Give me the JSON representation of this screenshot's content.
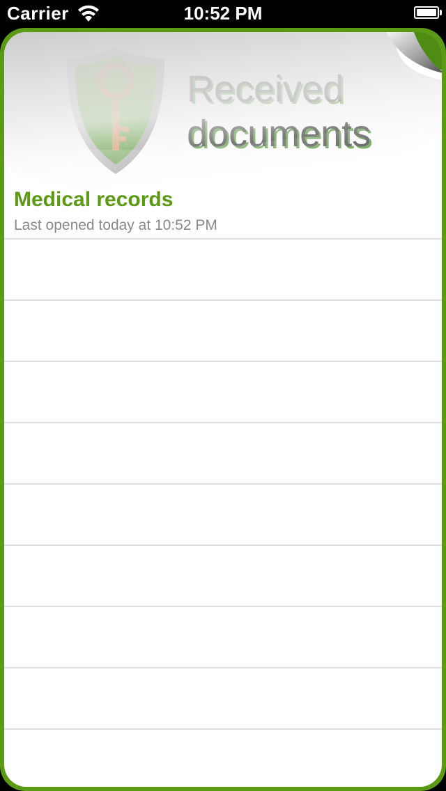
{
  "status_bar": {
    "carrier": "Carrier",
    "time": "10:52 PM"
  },
  "header": {
    "title_line1": "Received",
    "title_line2": "documents",
    "logo_icon": "shield-key-icon"
  },
  "documents": [
    {
      "title": "Medical records",
      "subtitle": "Last opened today at 10:52 PM"
    }
  ],
  "colors": {
    "accent": "#5a9a14",
    "subtitle": "#888888",
    "separator": "#dedede"
  }
}
